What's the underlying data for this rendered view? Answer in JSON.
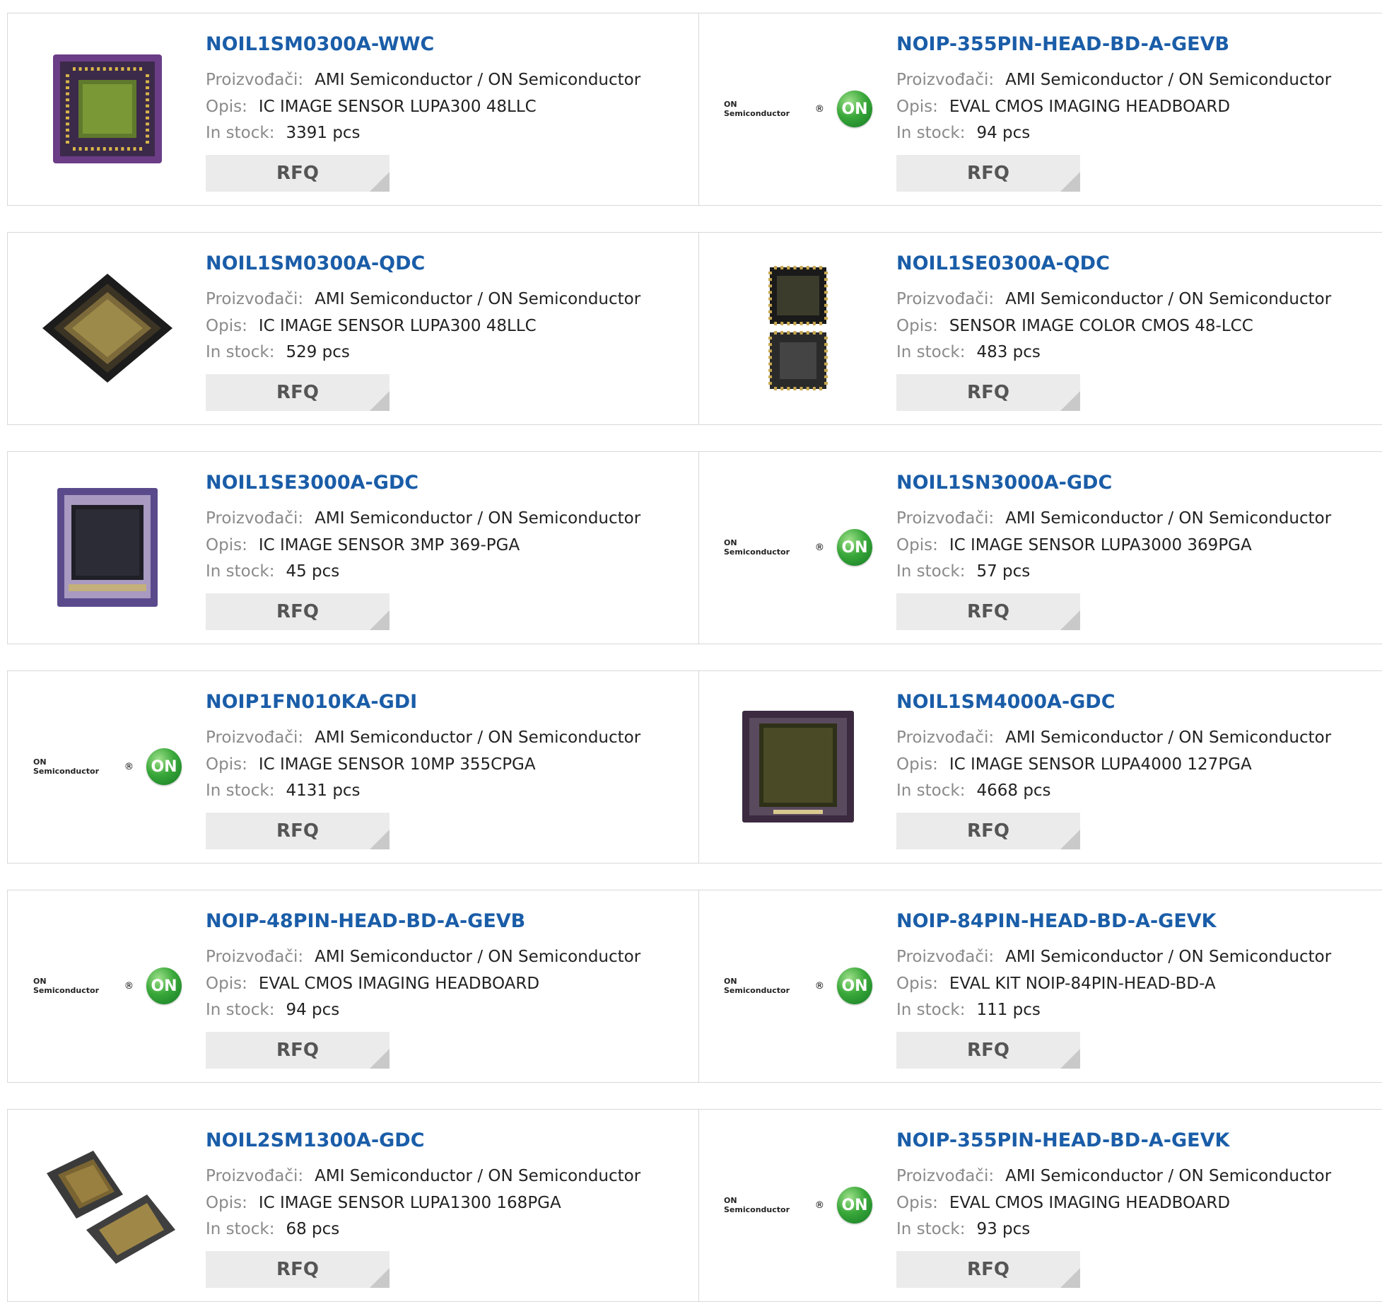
{
  "labels": {
    "manufacturer": "Proizvođači:",
    "description": "Opis:",
    "stock": "In stock:",
    "rfq": "RFQ"
  },
  "brand_logo": {
    "text": "ON Semiconductor",
    "badge": "ON",
    "mark": "®"
  },
  "products": [
    {
      "name": "NOIL1SM0300A-WWC",
      "manufacturer": "AMI Semiconductor / ON Semiconductor",
      "description": "IC IMAGE SENSOR LUPA300 48LLC",
      "stock": "3391 pcs",
      "image": "purple-chip-icon"
    },
    {
      "name": "NOIP-355PIN-HEAD-BD-A-GEVB",
      "manufacturer": "AMI Semiconductor / ON Semiconductor",
      "description": "EVAL CMOS IMAGING HEADBOARD",
      "stock": "94 pcs",
      "image": "on-semiconductor-logo"
    },
    {
      "name": "NOIL1SM0300A-QDC",
      "manufacturer": "AMI Semiconductor / ON Semiconductor",
      "description": "IC IMAGE SENSOR LUPA300 48LLC",
      "stock": "529 pcs",
      "image": "tilted-chip-icon"
    },
    {
      "name": "NOIL1SE0300A-QDC",
      "manufacturer": "AMI Semiconductor / ON Semiconductor",
      "description": "SENSOR IMAGE COLOR CMOS 48-LCC",
      "stock": "483 pcs",
      "image": "stacked-chips-icon"
    },
    {
      "name": "NOIL1SE3000A-GDC",
      "manufacturer": "AMI Semiconductor / ON Semiconductor",
      "description": "IC IMAGE SENSOR 3MP 369-PGA",
      "stock": "45 pcs",
      "image": "purple-pga-chip-icon"
    },
    {
      "name": "NOIL1SN3000A-GDC",
      "manufacturer": "AMI Semiconductor / ON Semiconductor",
      "description": "IC IMAGE SENSOR LUPA3000 369PGA",
      "stock": "57 pcs",
      "image": "on-semiconductor-logo"
    },
    {
      "name": "NOIP1FN010KA-GDI",
      "manufacturer": "AMI Semiconductor / ON Semiconductor",
      "description": "IC IMAGE SENSOR 10MP 355CPGA",
      "stock": "4131 pcs",
      "image": "on-semiconductor-logo"
    },
    {
      "name": "NOIL1SM4000A-GDC",
      "manufacturer": "AMI Semiconductor / ON Semiconductor",
      "description": "IC IMAGE SENSOR LUPA4000 127PGA",
      "stock": "4668 pcs",
      "image": "dark-purple-chip-icon"
    },
    {
      "name": "NOIP-48PIN-HEAD-BD-A-GEVB",
      "manufacturer": "AMI Semiconductor / ON Semiconductor",
      "description": "EVAL CMOS IMAGING HEADBOARD",
      "stock": "94 pcs",
      "image": "on-semiconductor-logo"
    },
    {
      "name": "NOIP-84PIN-HEAD-BD-A-GEVK",
      "manufacturer": "AMI Semiconductor / ON Semiconductor",
      "description": "EVAL KIT NOIP-84PIN-HEAD-BD-A",
      "stock": "111 pcs",
      "image": "on-semiconductor-logo"
    },
    {
      "name": "NOIL2SM1300A-GDC",
      "manufacturer": "AMI Semiconductor / ON Semiconductor",
      "description": "IC IMAGE SENSOR LUPA1300 168PGA",
      "stock": "68 pcs",
      "image": "two-chips-icon"
    },
    {
      "name": "NOIP-355PIN-HEAD-BD-A-GEVK",
      "manufacturer": "AMI Semiconductor / ON Semiconductor",
      "description": "EVAL CMOS IMAGING HEADBOARD",
      "stock": "93 pcs",
      "image": "on-semiconductor-logo"
    }
  ]
}
